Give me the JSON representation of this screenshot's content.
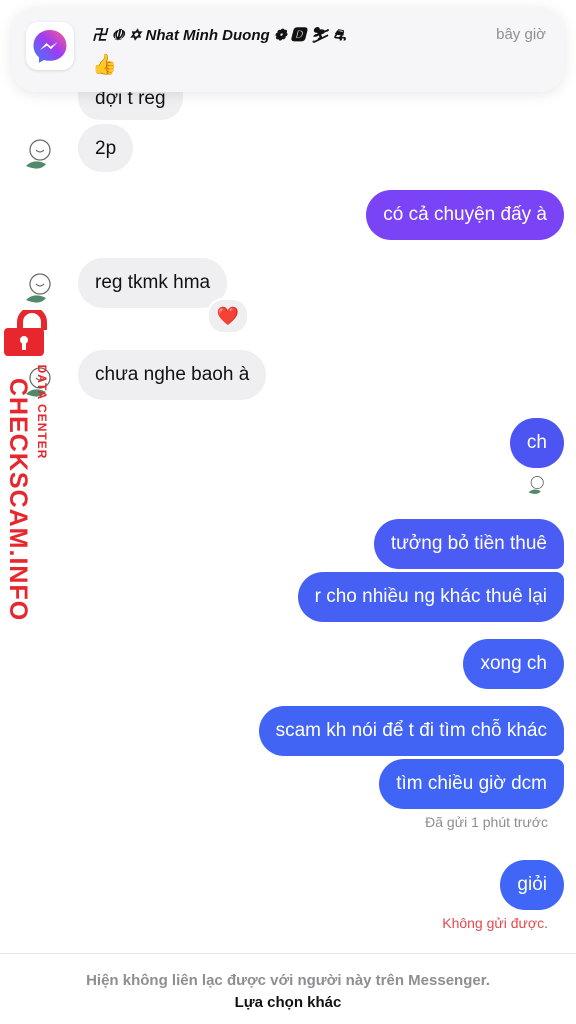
{
  "notification": {
    "sender": "卍 ☫ ✡ Nhat Minh Duong ❁ 🅳 ⛷ ⛐",
    "time": "bây giờ",
    "preview": "👍",
    "app_icon": "messenger-icon"
  },
  "watermark": {
    "brand": "CHECKSCAM.INFO",
    "sub": "DATA CENTER",
    "icon": "padlock-icon",
    "color": "#e8262d"
  },
  "colors": {
    "incoming": "#efeff1",
    "outgoing_purple": "#7a43f5",
    "outgoing_blue": "#3f64f5",
    "error": "#e5484d"
  },
  "messages": [
    {
      "dir": "in",
      "text": "đợi t reg"
    },
    {
      "dir": "in",
      "text": "2p"
    },
    {
      "dir": "out",
      "text": "có cả chuyện đấy à"
    },
    {
      "dir": "in",
      "text": "reg tkmk hma",
      "reaction": "❤️"
    },
    {
      "dir": "in",
      "text": "chưa nghe baoh à"
    },
    {
      "dir": "out",
      "text": "ch"
    },
    {
      "dir": "out",
      "text": "tưởng bỏ tiền thuê"
    },
    {
      "dir": "out",
      "text": "r cho nhiều ng khác thuê lại"
    },
    {
      "dir": "out",
      "text": "xong ch"
    },
    {
      "dir": "out",
      "text": "scam kh nói để t đi tìm chỗ khác"
    },
    {
      "dir": "out",
      "text": "tìm chiều giờ dcm"
    },
    {
      "dir": "out",
      "text": "giỏi"
    }
  ],
  "sent_status": "Đã gửi 1 phút trước",
  "error_status": "Không gửi được.",
  "footer": {
    "notice": "Hiện không liên lạc được với người này trên Messenger.",
    "action": "Lựa chọn khác"
  }
}
